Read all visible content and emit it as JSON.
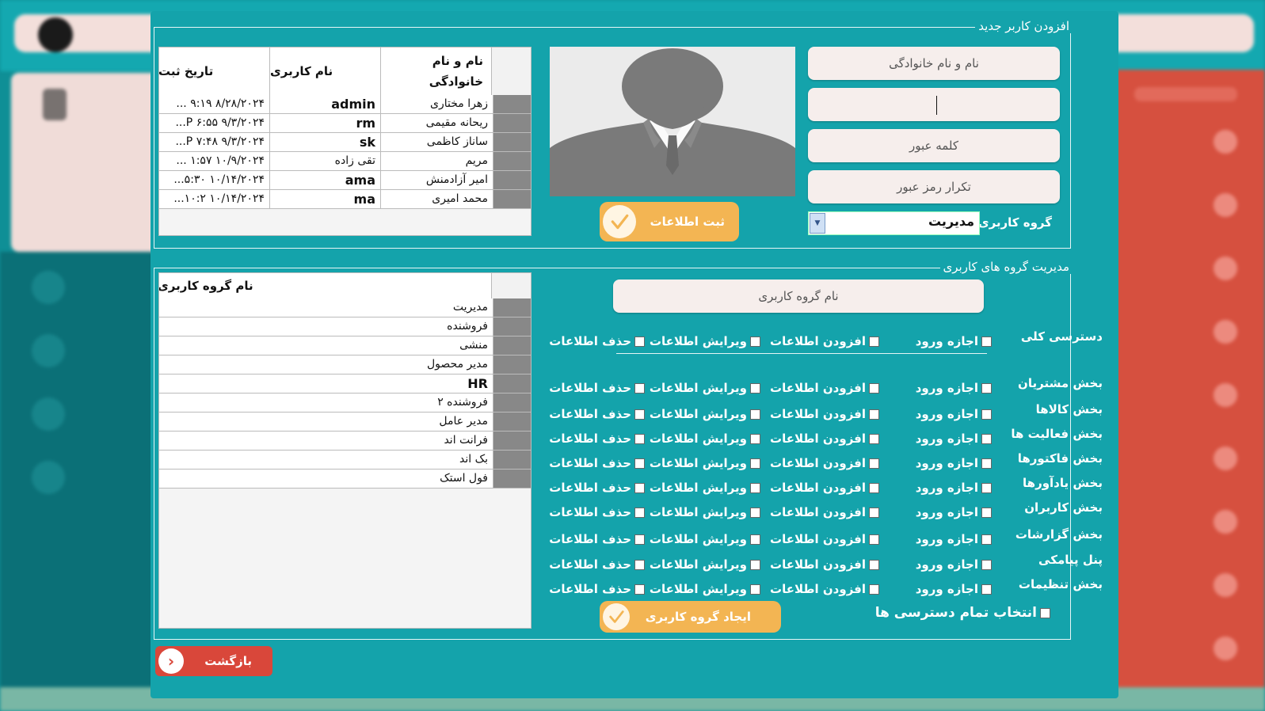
{
  "new_user": {
    "legend": "افزودن کاربر جدید",
    "fields": {
      "fullname_placeholder": "نام و نام خانوادگی",
      "username_value": "",
      "password_placeholder": "کلمه عبور",
      "password_repeat_placeholder": "تکرار رمز عبور"
    },
    "group_label": "گروه کاربری",
    "group_selected": "مدیریت",
    "save_label": "ثبت اطلاعات"
  },
  "users_table": {
    "headers": {
      "fullname": "نام و نام خانوادگی",
      "username": "نام کاربری",
      "date": "تاریخ ثبت"
    },
    "rows": [
      {
        "fullname": "زهرا مختاری",
        "username": "admin",
        "date": "۸/۲۸/۲۰۲۴ ۹:۱۹ ..."
      },
      {
        "fullname": "ریحانه مقیمی",
        "username": "rm",
        "date": "۹/۳/۲۰۲۴ ۶:۵۵ P..."
      },
      {
        "fullname": "ساناز کاظمی",
        "username": "sk",
        "date": "۹/۳/۲۰۲۴ ۷:۴۸ P..."
      },
      {
        "fullname": "مریم",
        "username": "تقی زاده",
        "date": "۱۰/۹/۲۰۲۴ ۱:۵۷ ..."
      },
      {
        "fullname": "امیر آزادمنش",
        "username": "ama",
        "date": "۱۰/۱۴/۲۰۲۴ ۵:۳۰..."
      },
      {
        "fullname": "محمد امیری",
        "username": "ma",
        "date": "۱۰/۱۴/۲۰۲۴ ۱۰:۲..."
      }
    ]
  },
  "groups": {
    "legend": "مدیریت گروه های کاربری",
    "name_placeholder": "نام گروه کاربری",
    "table_header": "نام گروه کاربری",
    "list": [
      "مدیریت",
      "فروشنده",
      "منشی",
      "مدیر محصول",
      "HR",
      "فروشنده ۲",
      "مدیر عامل",
      "فرانت اند",
      "بک اند",
      "فول استک"
    ],
    "perm_labels": {
      "login": "اجازه ورود",
      "add": "افزودن اطلاعات",
      "edit": "ویرایش اطلاعات",
      "delete": "حذف اطلاعات"
    },
    "general_access": "دسترسی کلی",
    "sections": [
      "بخش مشتریان",
      "بخش کالاها",
      "بخش فعالیت ها",
      "بخش فاکتورها",
      "بخش یادآورها",
      "بخش کاربران",
      "بخش گزارشات",
      "پنل پیامکی",
      "بخش تنظیمات"
    ],
    "select_all_label": "انتخاب تمام دسترسی ها",
    "create_label": "ایجاد گروه کاربری"
  },
  "back_label": "بازگشت",
  "colors": {
    "dialog": "#14a3ab",
    "accent_yellow": "#f3b553",
    "back_red": "#d9473a"
  }
}
